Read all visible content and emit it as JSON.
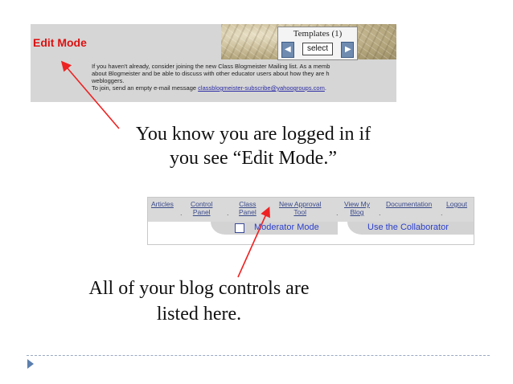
{
  "edit_panel": {
    "edit_mode_label": "Edit Mode",
    "templates_title": "Templates (1)",
    "select_label": "select",
    "mail_lines": [
      "If you haven't already, consider joining the new Class Blogmeister Mailing list. As a memb",
      "about Blogmeister and be able to discuss with other educator users about how they are h",
      "webloggers.",
      "To join, send an empty e-mail message "
    ],
    "mail_link": "classblogmeister-subscribe@yahoogroups.com",
    "mail_link_suffix": "."
  },
  "caption_top": [
    "You know you are logged in if",
    "you see “Edit Mode.”"
  ],
  "control_bar": {
    "nav": [
      {
        "line1": "Articles",
        "line2": ""
      },
      {
        "line1": "Control",
        "line2": "Panel"
      },
      {
        "line1": "Class",
        "line2": "Panel"
      },
      {
        "line1": "New Approval",
        "line2": "Tool"
      },
      {
        "line1": "View My",
        "line2": "Blog"
      },
      {
        "line1": "Documentation",
        "line2": ""
      },
      {
        "line1": "Logout",
        "line2": ""
      }
    ],
    "moderator_mode": "Moderator Mode",
    "use_collaborator": "Use the Collaborator"
  },
  "caption_bottom": [
    "All of your blog controls are",
    "listed here."
  ],
  "colors": {
    "edit_mode": "#dd1111",
    "arrow": "#ee2222",
    "link_blue": "#2b3fcc",
    "footer_accent": "#5b7fae"
  },
  "icons": [
    "arrow-left-icon",
    "arrow-right-icon",
    "checkbox-icon",
    "bullet-triangle-icon"
  ]
}
